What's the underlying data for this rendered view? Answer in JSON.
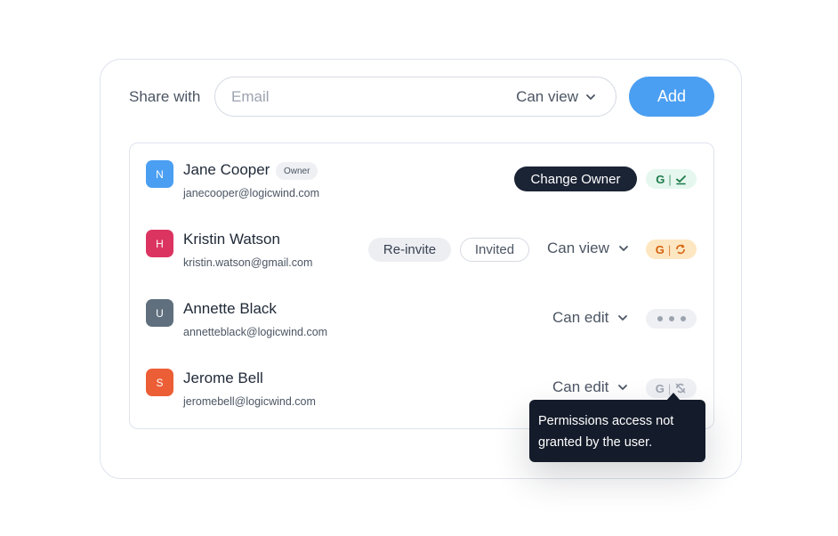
{
  "share": {
    "label": "Share with",
    "email_placeholder": "Email",
    "email_value": "",
    "permission": "Can view",
    "add_label": "Add"
  },
  "users": [
    {
      "initial": "N",
      "name": "Jane Cooper",
      "email": "janecooper@logicwind.com",
      "badge": "Owner",
      "action": "Change Owner",
      "avatar_color": "#4b9ff2",
      "status": "connected"
    },
    {
      "initial": "H",
      "name": "Kristin Watson",
      "email": "kristin.watson@gmail.com",
      "reinvite": "Re-invite",
      "invited": "Invited",
      "permission": "Can view",
      "avatar_color": "#dc3461",
      "status": "pending"
    },
    {
      "initial": "U",
      "name": "Annette Black",
      "email": "annetteblack@logicwind.com",
      "permission": "Can edit",
      "avatar_color": "#5f6f7d",
      "status": "more"
    },
    {
      "initial": "S",
      "name": "Jerome Bell",
      "email": "jeromebell@logicwind.com",
      "permission": "Can edit",
      "avatar_color": "#ec5e36",
      "status": "not-granted"
    }
  ],
  "status_letter": "G",
  "tooltip": {
    "line1": "Permissions access not",
    "line2": "granted by the user."
  },
  "colors": {
    "accent": "#4b9ff2",
    "dark": "#1b2435",
    "green_bg": "#e5f7ee",
    "orange_bg": "#fde7c2"
  }
}
